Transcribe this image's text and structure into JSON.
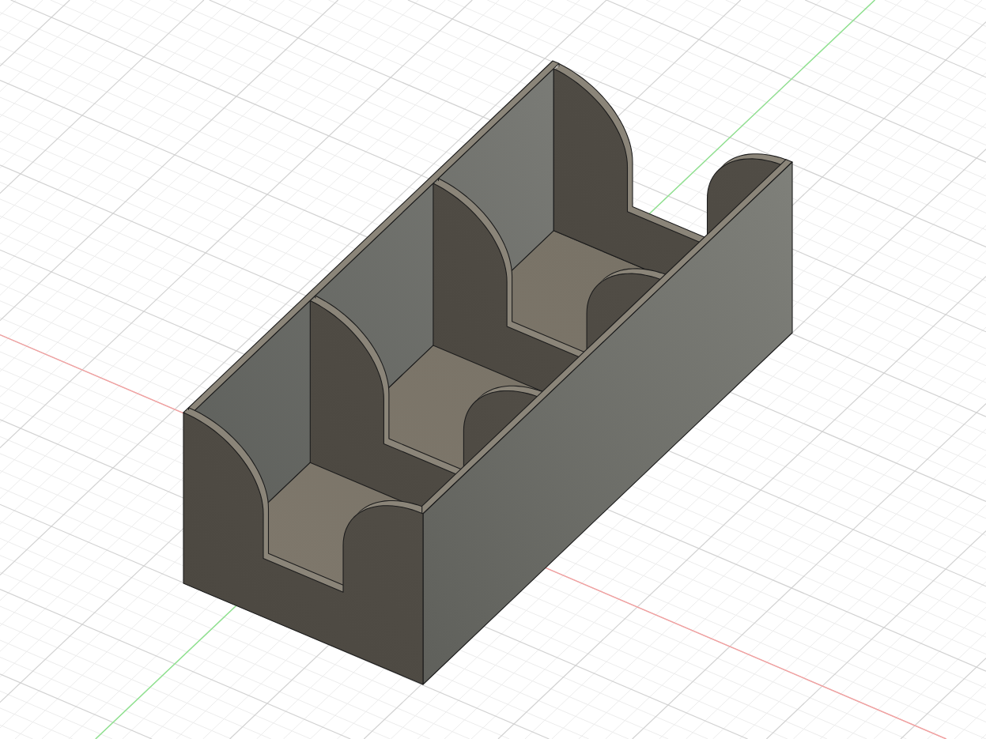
{
  "viewport": {
    "axes": [
      {
        "kind": "x",
        "color": "#f4a0a0"
      },
      {
        "kind": "y",
        "color": "#8fe48f"
      }
    ]
  }
}
